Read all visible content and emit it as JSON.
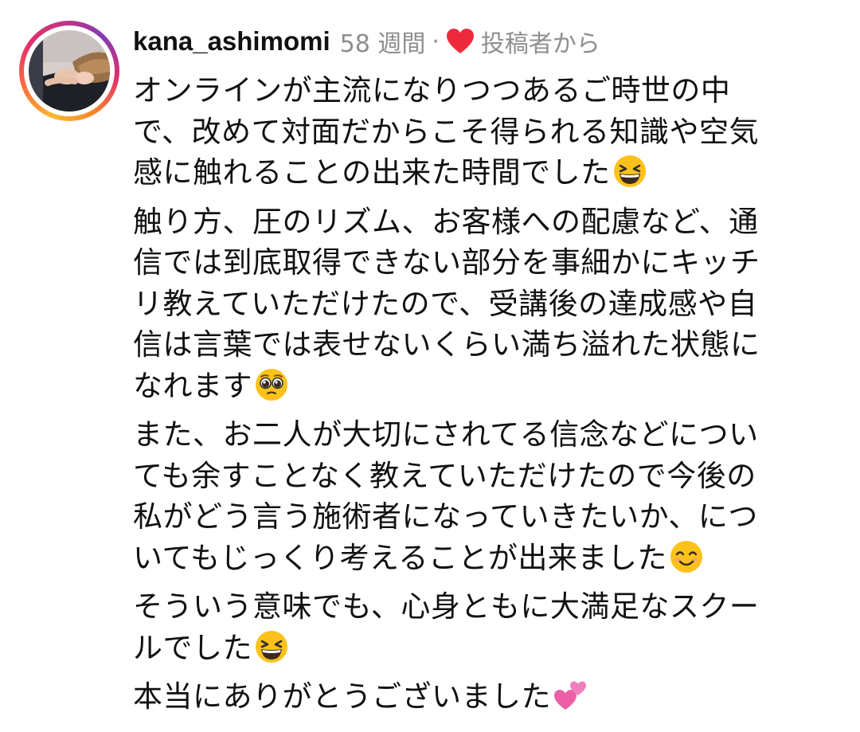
{
  "comment": {
    "username": "kana_ashimomi",
    "age": "58 週間",
    "separator": "·",
    "liked_by_author": "投稿者から",
    "heart_color": "#ed2a3c",
    "paragraphs": [
      {
        "lines": [
          "オンラインが主流になりつつあるご時世の中",
          "で、改めて対面だからこそ得られる知識や空気",
          "感に触れることの出来た時間でした"
        ],
        "emoji": "grinning-squinting-face-emoji"
      },
      {
        "lines": [
          "触り方、圧のリズム、お客様への配慮など、通",
          "信では到底取得できない部分を事細かにキッチ",
          "リ教えていただけたので、受講後の達成感や自",
          "信は言葉では表せないくらい満ち溢れた状態に",
          "なれます"
        ],
        "emoji": "pleading-face-emoji"
      },
      {
        "lines": [
          "また、お二人が大切にされてる信念などについ",
          "ても余すことなく教えていただけたので今後の",
          "私がどう言う施術者になっていきたいか、につ",
          "いてもじっくり考えることが出来ました"
        ],
        "emoji": "smiling-face-emoji"
      },
      {
        "lines": [
          "そういう意味でも、心身ともに大満足なスクー",
          "ルでした"
        ],
        "emoji": "grinning-squinting-face-emoji"
      },
      {
        "lines": [
          "本当にありがとうございました"
        ],
        "emoji": "two-hearts-emoji"
      }
    ]
  }
}
